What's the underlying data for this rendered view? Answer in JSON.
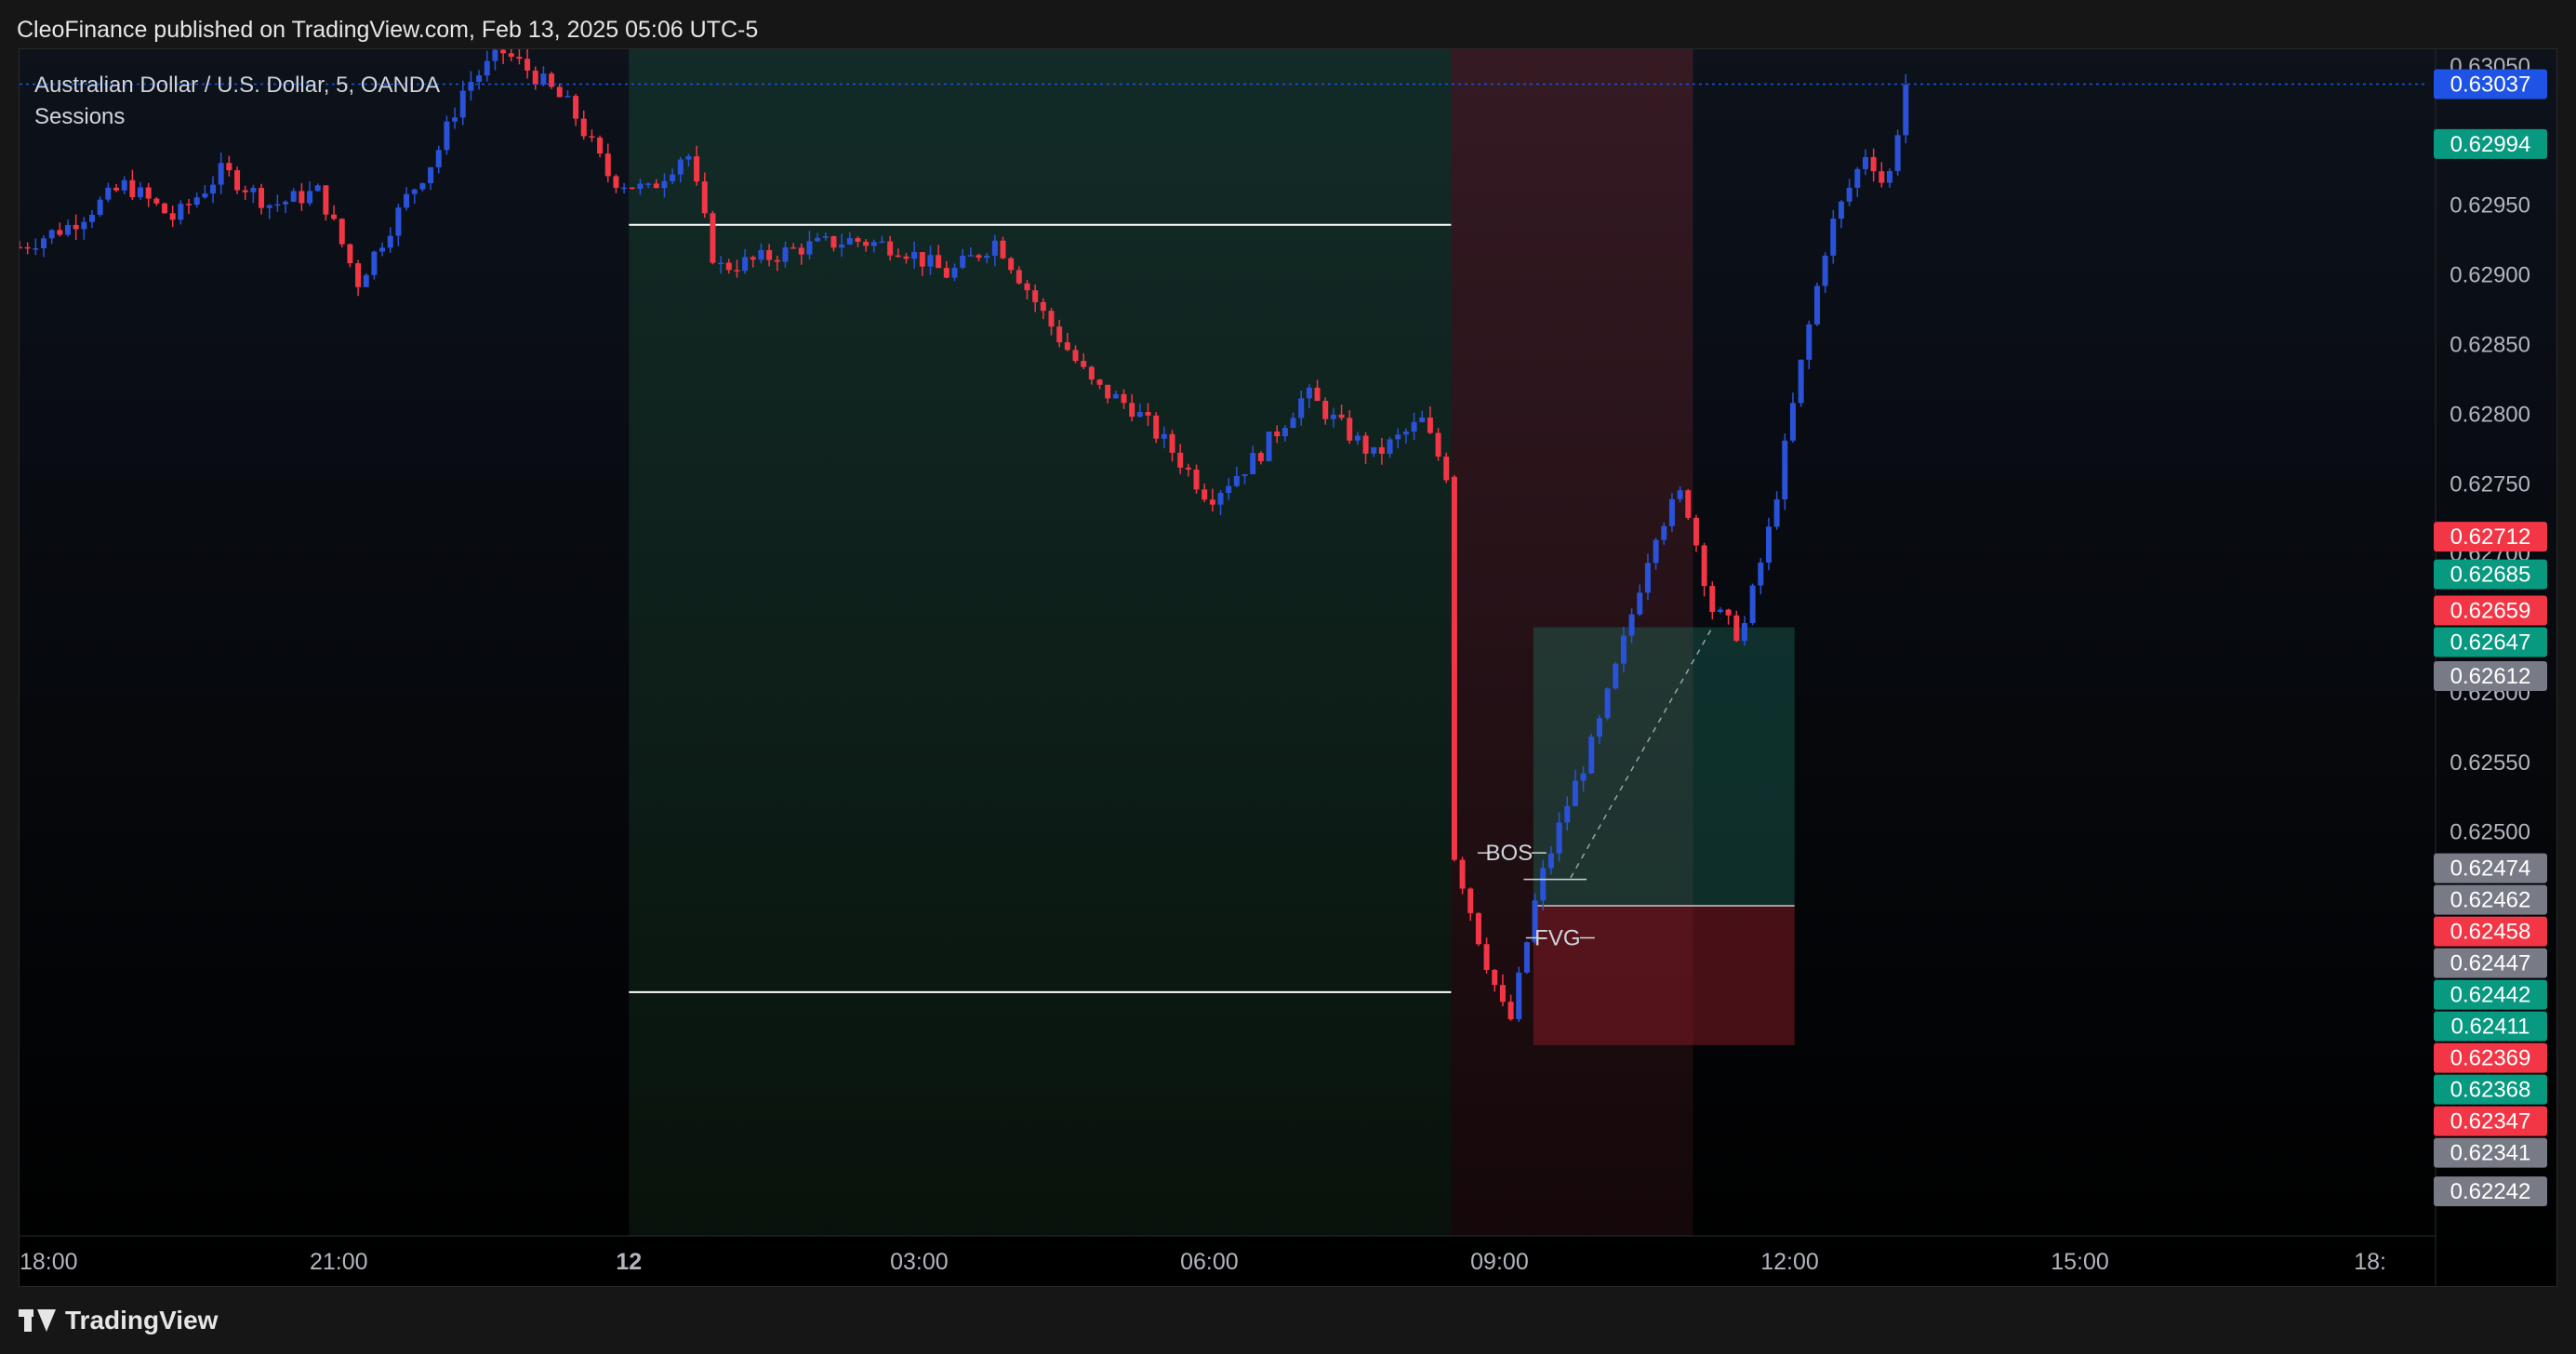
{
  "header": {
    "published": "CleoFinance published on TradingView.com, Feb 13, 2025 05:06 UTC-5"
  },
  "footer": {
    "brand": "TradingView"
  },
  "colors": {
    "up": "#2a52d8",
    "down": "#f23645",
    "green_tag": "#089981",
    "gray_tag": "#787b86",
    "blue_tag": "#1e53e5",
    "red_tag": "#f23645"
  },
  "chart_data": {
    "type": "candlestick",
    "title": "Australian Dollar / U.S. Dollar, 5, OANDA",
    "indicator": "Sessions",
    "x_ticks": [
      "18:00",
      "21:00",
      "12",
      "03:00",
      "06:00",
      "09:00",
      "12:00",
      "15:00",
      "18:"
    ],
    "x_range_hours": [
      17.7,
      42.6
    ],
    "y_range": [
      0.6221,
      0.63062
    ],
    "y_ticks": [
      "0.63050",
      "0.62950",
      "0.62900",
      "0.62850",
      "0.62800",
      "0.62750",
      "0.62700",
      "0.62600",
      "0.62550",
      "0.62500"
    ],
    "last_price": 0.63037,
    "price_tags": [
      {
        "value": 0.63037,
        "color": "blue"
      },
      {
        "value": 0.62994,
        "color": "green"
      },
      {
        "value": 0.62712,
        "color": "red"
      },
      {
        "value": 0.62685,
        "color": "green"
      },
      {
        "value": 0.62659,
        "color": "red"
      },
      {
        "value": 0.62647,
        "color": "green"
      },
      {
        "value": 0.62612,
        "color": "gray"
      },
      {
        "value": 0.62474,
        "color": "gray"
      },
      {
        "value": 0.62462,
        "color": "gray"
      },
      {
        "value": 0.62458,
        "color": "red"
      },
      {
        "value": 0.62447,
        "color": "gray"
      },
      {
        "value": 0.62442,
        "color": "green"
      },
      {
        "value": 0.62411,
        "color": "green"
      },
      {
        "value": 0.62369,
        "color": "red"
      },
      {
        "value": 0.62368,
        "color": "green"
      },
      {
        "value": 0.62347,
        "color": "red"
      },
      {
        "value": 0.62341,
        "color": "gray"
      },
      {
        "value": 0.62242,
        "color": "gray"
      }
    ],
    "sessions": [
      {
        "start_h": 24.0,
        "end_h": 32.5,
        "color": "green"
      },
      {
        "start_h": 32.5,
        "end_h": 35.0,
        "color": "red"
      }
    ],
    "range_lines": [
      {
        "start_h": 24.0,
        "end_h": 32.5,
        "price": 0.62936
      },
      {
        "start_h": 24.0,
        "end_h": 32.5,
        "price": 0.62385
      }
    ],
    "position": {
      "start_h": 33.35,
      "end_h": 36.05,
      "target": 0.62647,
      "entry": 0.62447,
      "stop": 0.62347
    },
    "annotations": [
      {
        "label": "BOS",
        "h": 33.1,
        "price": 0.62485
      },
      {
        "label": "FVG",
        "h": 33.6,
        "price": 0.62424
      }
    ],
    "path": [
      [
        17.7,
        0.6292
      ],
      [
        18.2,
        0.62935
      ],
      [
        18.8,
        0.62965
      ],
      [
        19.3,
        0.6294
      ],
      [
        19.8,
        0.62975
      ],
      [
        20.3,
        0.6295
      ],
      [
        20.8,
        0.6296
      ],
      [
        21.2,
        0.62895
      ],
      [
        21.7,
        0.62955
      ],
      [
        22.0,
        0.62985
      ],
      [
        22.3,
        0.63035
      ],
      [
        22.7,
        0.6306
      ],
      [
        23.0,
        0.63045
      ],
      [
        23.4,
        0.6302
      ],
      [
        23.8,
        0.6297
      ],
      [
        24.2,
        0.6296
      ],
      [
        24.6,
        0.6299
      ],
      [
        24.9,
        0.62905
      ],
      [
        25.3,
        0.6291
      ],
      [
        25.8,
        0.6292
      ],
      [
        26.3,
        0.62925
      ],
      [
        26.8,
        0.6292
      ],
      [
        27.3,
        0.629
      ],
      [
        27.8,
        0.62925
      ],
      [
        28.3,
        0.6287
      ],
      [
        28.8,
        0.6282
      ],
      [
        29.2,
        0.62805
      ],
      [
        29.6,
        0.62775
      ],
      [
        30.0,
        0.6274
      ],
      [
        30.5,
        0.6277
      ],
      [
        31.0,
        0.62815
      ],
      [
        31.3,
        0.62795
      ],
      [
        31.7,
        0.6277
      ],
      [
        32.2,
        0.62795
      ],
      [
        32.5,
        0.6275
      ],
      [
        32.55,
        0.6248
      ],
      [
        32.8,
        0.6242
      ],
      [
        33.1,
        0.6236
      ],
      [
        33.4,
        0.6246
      ],
      [
        33.7,
        0.6252
      ],
      [
        34.0,
        0.6257
      ],
      [
        34.3,
        0.6264
      ],
      [
        34.6,
        0.62715
      ],
      [
        34.9,
        0.62745
      ],
      [
        35.2,
        0.6266
      ],
      [
        35.5,
        0.6264
      ],
      [
        35.8,
        0.6272
      ],
      [
        36.1,
        0.6283
      ],
      [
        36.4,
        0.6293
      ],
      [
        36.8,
        0.6299
      ],
      [
        37.0,
        0.6296
      ],
      [
        37.2,
        0.63037
      ]
    ]
  }
}
